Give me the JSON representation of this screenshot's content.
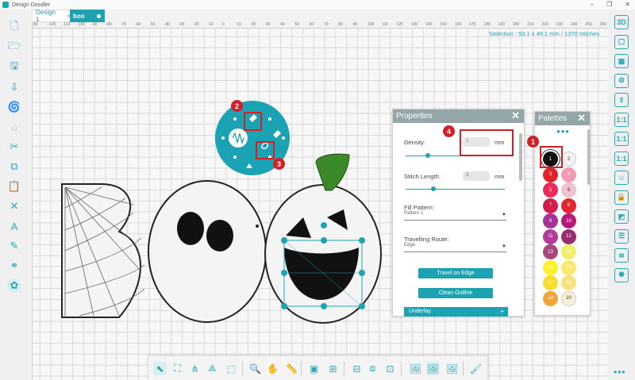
{
  "window": {
    "title": "Design Doodler",
    "buttons": [
      "–",
      "❐",
      "✕"
    ]
  },
  "tabs": [
    {
      "label": "Design 1",
      "close": "×"
    },
    {
      "label": "boo"
    }
  ],
  "ruler": [
    "80",
    "-120",
    "-110",
    "-100",
    "-90",
    "-80",
    "-70",
    "-60",
    "-50",
    "-40",
    "-30",
    "-20",
    "-10",
    "0",
    "10",
    "20",
    "30",
    "40",
    "50",
    "60",
    "70",
    "80",
    "90",
    "100",
    "110",
    "120",
    "130",
    "140",
    "150",
    "160",
    "170",
    "180",
    "190",
    "200",
    "210",
    "220",
    "230",
    "240",
    "250",
    "260",
    "270"
  ],
  "selection_info": "Selection : 53.1 x 45.1 mm / 1370 stitches",
  "left_toolbar": [
    "new-file-icon",
    "open-folder-icon",
    "save-icon",
    "import-icon",
    "spiral-tool-icon",
    "spiral-outline-icon",
    "scissors-icon",
    "copy-icon",
    "paste-icon",
    "delete-icon",
    "text-icon",
    "pen-tool-icon",
    "link-icon",
    "fill-stitch-icon"
  ],
  "right_toolbar": [
    {
      "icon": "3d-view-icon",
      "label": "3D"
    },
    {
      "icon": "hoop-icon",
      "label": "▢"
    },
    {
      "icon": "grid-icon",
      "label": "▦"
    },
    {
      "icon": "settings-hoop-icon",
      "label": "⚙"
    },
    {
      "icon": "export-icon",
      "label": "⇪"
    },
    {
      "icon": "zoom-1-1-icon",
      "label": "1:1"
    },
    {
      "icon": "zoom-1-1-alt-icon",
      "label": "1:1"
    },
    {
      "icon": "scale-icon",
      "label": "1:1"
    },
    {
      "icon": "head-icon",
      "label": "☺"
    },
    {
      "icon": "lock-icon",
      "label": "🔒"
    },
    {
      "icon": "density-icon",
      "label": "◩"
    },
    {
      "icon": "align-icon",
      "label": "☰"
    },
    {
      "icon": "layers-icon",
      "label": "≋"
    },
    {
      "icon": "palette-icon",
      "label": "✺"
    }
  ],
  "radial_menu": {
    "items": [
      "stitch-icon",
      "brush-icon",
      "wave-icon",
      "stroke-icon",
      "needle-icon",
      "fill-icon"
    ]
  },
  "properties": {
    "title": "Properties",
    "close": "✕",
    "density_label": "Density:",
    "density_value": "1",
    "density_unit": "mm",
    "stitch_label": "Stitch Length:",
    "stitch_value": "3",
    "stitch_unit": "mm",
    "fill_label": "Fill Pattern:",
    "fill_value": "Pattern 1",
    "route_label": "Travelling Route:",
    "route_value": "Edge",
    "btn_travel": "Travel on Edge",
    "btn_clean": "Clean Outline",
    "underlay": "Underlay",
    "underlay_plus": "+",
    "density_level": 0.22,
    "stitch_level": 0.28
  },
  "palettes": {
    "title": "Palettes",
    "close": "✕",
    "dots": "•••",
    "swatches": [
      {
        "n": "1",
        "color": "#111111"
      },
      {
        "n": "2",
        "color": "#f2f2f2"
      },
      {
        "n": "3",
        "color": "#e0242a"
      },
      {
        "n": "4",
        "color": "#f49ab4"
      },
      {
        "n": "5",
        "color": "#ec2a5a"
      },
      {
        "n": "6",
        "color": "#f6c0cc"
      },
      {
        "n": "7",
        "color": "#d41a4a"
      },
      {
        "n": "8",
        "color": "#e3262d"
      },
      {
        "n": "9",
        "color": "#a8309a"
      },
      {
        "n": "10",
        "color": "#b5187a"
      },
      {
        "n": "11",
        "color": "#b23a9a"
      },
      {
        "n": "12",
        "color": "#9a2a72"
      },
      {
        "n": "13",
        "color": "#a8457a"
      },
      {
        "n": "14",
        "color": "#f1ee6a"
      },
      {
        "n": "15",
        "color": "#fff02a"
      },
      {
        "n": "16",
        "color": "#fbe86a"
      },
      {
        "n": "17",
        "color": "#fbdc2a"
      },
      {
        "n": "18",
        "color": "#f8e27c"
      },
      {
        "n": "19",
        "color": "#f0a43a"
      },
      {
        "n": "20",
        "color": "#f8f0d8"
      }
    ]
  },
  "callouts": [
    "1",
    "2",
    "3",
    "4"
  ],
  "bottom_toolbar": [
    "select-icon",
    "transform-icon",
    "node-edit-icon",
    "reshape-icon",
    "pattern-icon",
    "zoom-icon",
    "hand-icon",
    "measure-icon",
    "crop-icon",
    "group-icon",
    "align-top-icon",
    "align-center-icon",
    "align-bottom-icon",
    "image-icon",
    "image-active-icon",
    "image-alt-icon",
    "brush-settings-icon"
  ],
  "more": "•••"
}
